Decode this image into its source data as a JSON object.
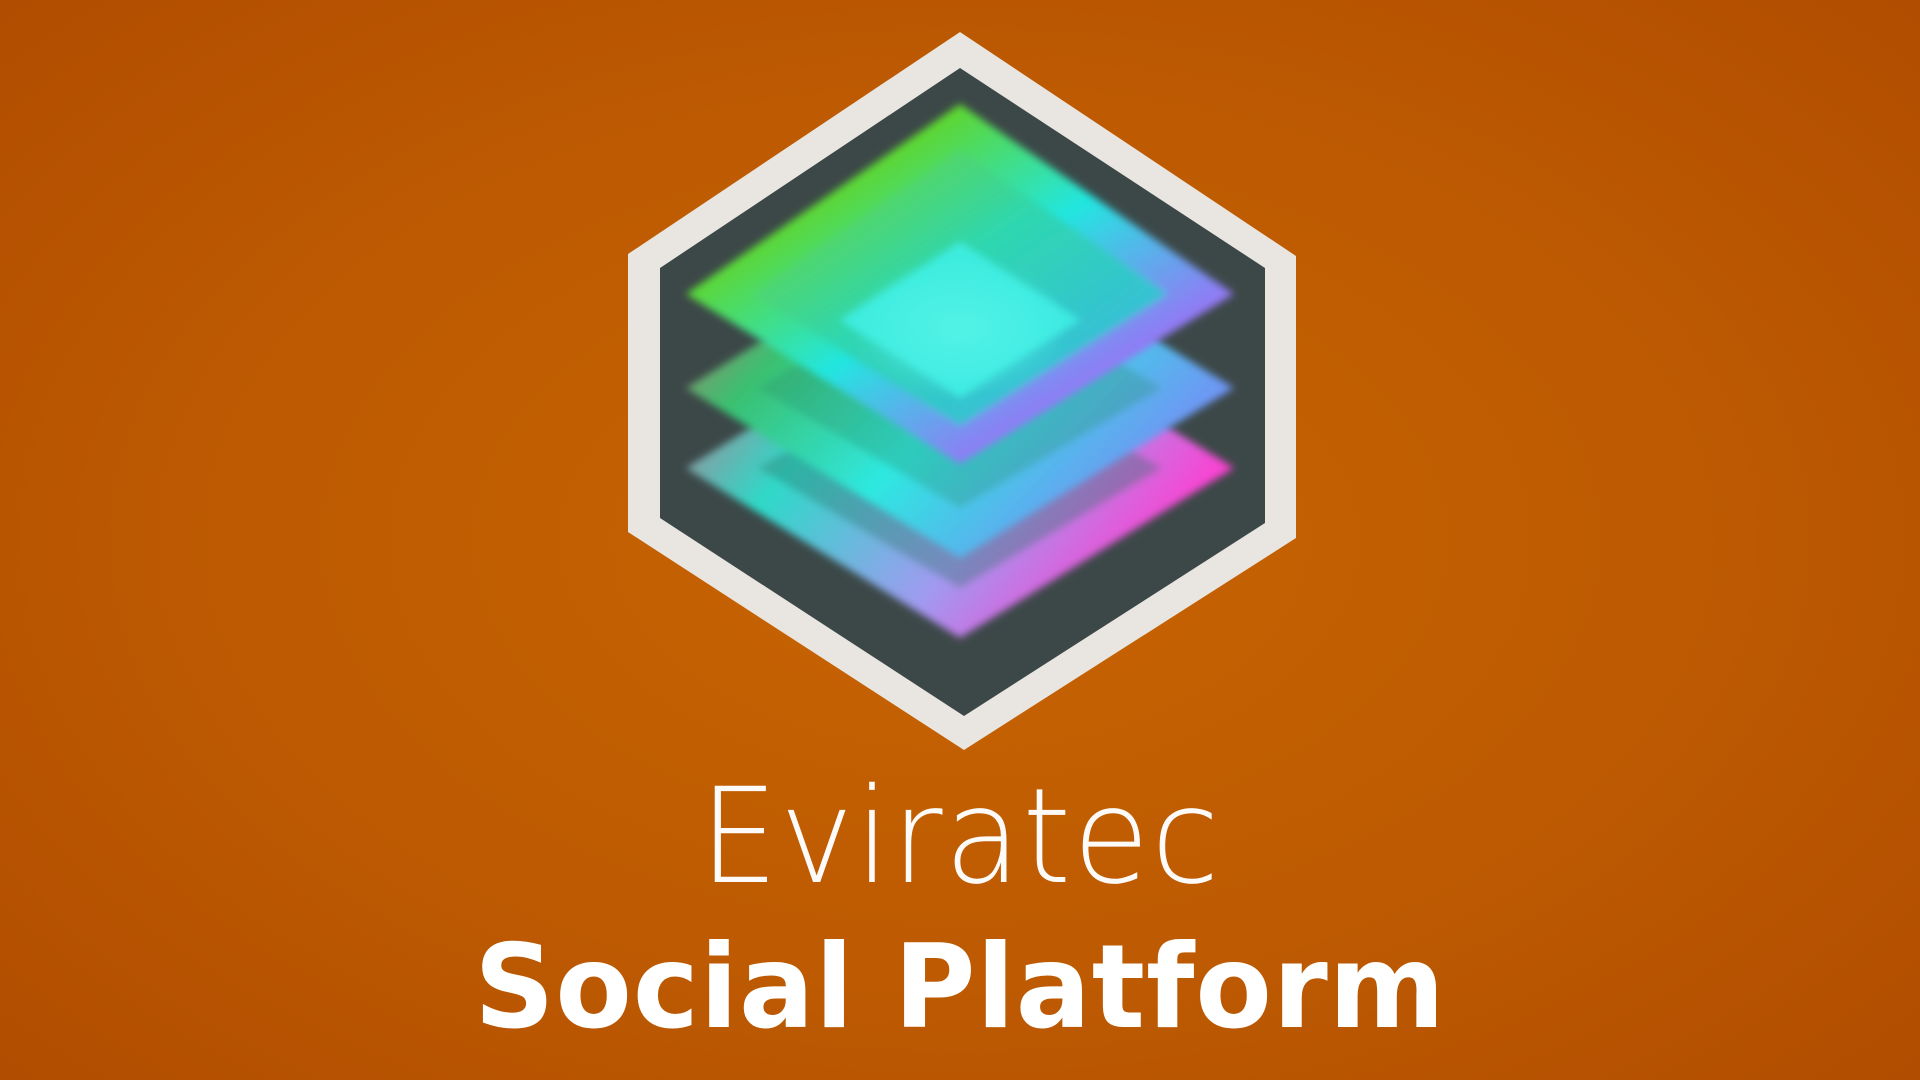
{
  "app": {
    "brand_name": "Eviratec",
    "product_title": "Social Platform"
  },
  "logo": {
    "icon": "layered-stack-hexagon-icon"
  },
  "colors": {
    "background": "#bd5a02",
    "logo_frame": "#e9e6e2",
    "logo_inner": "#3c4848",
    "text": "#ffffff"
  }
}
